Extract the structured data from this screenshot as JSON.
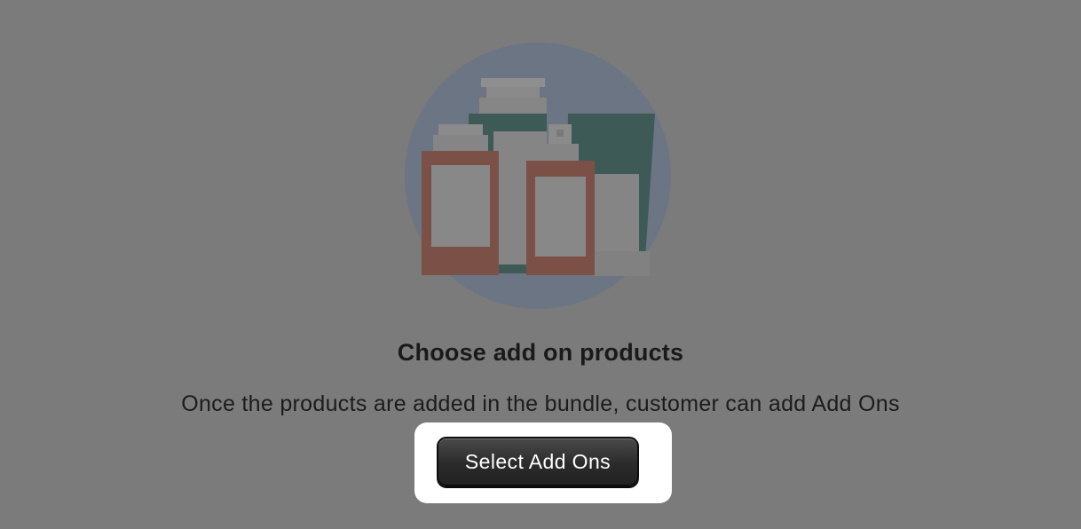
{
  "empty_state": {
    "illustration_icon": "product-bottles-icon",
    "title": "Choose add on products",
    "description": "Once the products are added in the bundle, customer can add Add Ons",
    "primary_action_label": "Select Add Ons"
  },
  "colors": {
    "overlay": "#7b7b7b",
    "circle": "#6b7584",
    "bottle_rust": "#7b5147",
    "bottle_teal": "#3e5a56",
    "button": "#2b2b2b",
    "spotlight": "#ffffff"
  }
}
